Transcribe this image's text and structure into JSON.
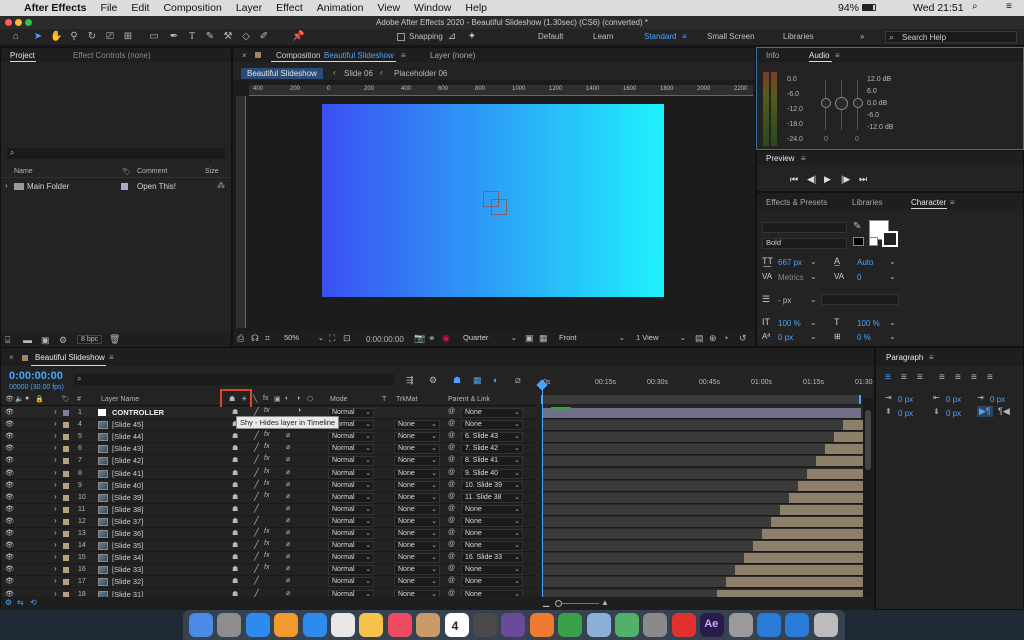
{
  "menubar": {
    "apple": "",
    "app_name": "After Effects",
    "items": [
      "File",
      "Edit",
      "Composition",
      "Layer",
      "Effect",
      "Animation",
      "View",
      "Window",
      "Help"
    ],
    "battery": "94%",
    "clock": "Wed 21:51"
  },
  "titlebar": {
    "title": "Adobe After Effects 2020 - Beautiful Slideshow (1.30sec) (CS6) (converted) *"
  },
  "toolbar": {
    "snapping_label": "Snapping",
    "workspaces": [
      "Default",
      "Learn",
      "Standard",
      "Small Screen",
      "Libraries"
    ],
    "active_workspace": "Standard",
    "search_placeholder": "Search Help"
  },
  "project_panel": {
    "tabs": [
      "Project",
      "Effect Controls (none)"
    ],
    "columns": {
      "name": "Name",
      "comment": "Comment",
      "size": "Size"
    },
    "items": [
      {
        "name": "Main Folder",
        "comment": "Open This!"
      }
    ],
    "bpc": "8 bpc"
  },
  "comp_panel": {
    "tab_prefix": "Composition",
    "comp_name": "Beautiful Slideshow",
    "layer_tab": "Layer (none)",
    "breadcrumbs": [
      "Beautiful Slideshow",
      "Slide 06",
      "Placeholder 06"
    ],
    "ruler_ticks": [
      "400",
      "200",
      "0",
      "200",
      "400",
      "600",
      "800",
      "1000",
      "1200",
      "1400",
      "1600",
      "1800",
      "2000",
      "2200"
    ],
    "zoom": "50%",
    "timecode": "0:00:00:00",
    "resolution": "Quarter",
    "view": "Front",
    "views_count": "1 View",
    "gradient": {
      "start": "#3b4ff2",
      "end": "#1ef2fb"
    }
  },
  "info_panel": {
    "tabs": [
      "Info",
      "Audio"
    ],
    "left_values": [
      "0.0",
      "-6.0",
      "-12.0",
      "-18.0",
      "-24.0"
    ],
    "right_values": [
      "12.0 dB",
      "6.0",
      "0.0 dB",
      "-6.0",
      "-12.0 dB"
    ],
    "zeros": [
      "0",
      "0"
    ]
  },
  "preview_panel": {
    "title": "Preview"
  },
  "effects_panel": {
    "tabs": [
      "Effects & Presets",
      "Libraries",
      "Character"
    ],
    "font_style": "Bold",
    "font_size": "667 px",
    "leading": "Auto",
    "kerning": "Metrics",
    "tracking": "0",
    "stroke_width": "- px",
    "vscale": "100 %",
    "hscale": "100 %",
    "baseline": "0 px",
    "tsume": "0 %"
  },
  "timeline": {
    "comp_name": "Beautiful Slideshow",
    "timecode": "0:00:00:00",
    "frames": "00000 (30.00 fps)",
    "columns": {
      "num": "#",
      "layer_name": "Layer Name",
      "mode": "Mode",
      "t": "T",
      "trkmat": "TrkMat",
      "parent": "Parent & Link"
    },
    "tooltip": "Shy - Hides layer in Timeline",
    "time_marks": [
      "0s",
      "00:15s",
      "00:30s",
      "00:45s",
      "01:00s",
      "01:15s",
      "01:30"
    ],
    "layers": [
      {
        "num": "1",
        "name": "CONTROLLER",
        "mode": "Normal",
        "trkmat": "",
        "parent": "None",
        "color": "#7d7d9e",
        "controller": true
      },
      {
        "num": "4",
        "name": "[Slide 45]",
        "mode": "Normal",
        "trkmat": "None",
        "parent": "None",
        "color": "#b3a37a"
      },
      {
        "num": "5",
        "name": "[Slide 44]",
        "mode": "Normal",
        "trkmat": "None",
        "parent": "6. Slide 43",
        "color": "#b3a37a"
      },
      {
        "num": "6",
        "name": "[Slide 43]",
        "mode": "Normal",
        "trkmat": "None",
        "parent": "7. Slide 42",
        "color": "#b3a37a"
      },
      {
        "num": "7",
        "name": "[Slide 42]",
        "mode": "Normal",
        "trkmat": "None",
        "parent": "8. Slide 41",
        "color": "#b3a37a"
      },
      {
        "num": "8",
        "name": "[Slide 41]",
        "mode": "Normal",
        "trkmat": "None",
        "parent": "9. Slide 40",
        "color": "#b3a37a"
      },
      {
        "num": "9",
        "name": "[Slide 40]",
        "mode": "Normal",
        "trkmat": "None",
        "parent": "10. Slide 39",
        "color": "#b3a37a"
      },
      {
        "num": "10",
        "name": "[Slide 39]",
        "mode": "Normal",
        "trkmat": "None",
        "parent": "11. Slide 38",
        "color": "#b3a37a"
      },
      {
        "num": "11",
        "name": "[Slide 38]",
        "mode": "Normal",
        "trkmat": "None",
        "parent": "None",
        "color": "#b3a37a"
      },
      {
        "num": "12",
        "name": "[Slide 37]",
        "mode": "Normal",
        "trkmat": "None",
        "parent": "None",
        "color": "#b3a37a"
      },
      {
        "num": "13",
        "name": "[Slide 36]",
        "mode": "Normal",
        "trkmat": "None",
        "parent": "None",
        "color": "#b3a37a"
      },
      {
        "num": "14",
        "name": "[Slide 35]",
        "mode": "Normal",
        "trkmat": "None",
        "parent": "None",
        "color": "#b3a37a"
      },
      {
        "num": "15",
        "name": "[Slide 34]",
        "mode": "Normal",
        "trkmat": "None",
        "parent": "16. Slide 33",
        "color": "#b3a37a"
      },
      {
        "num": "16",
        "name": "[Slide 33]",
        "mode": "Normal",
        "trkmat": "None",
        "parent": "None",
        "color": "#b3a37a"
      },
      {
        "num": "17",
        "name": "[Slide 32]",
        "mode": "Normal",
        "trkmat": "None",
        "parent": "None",
        "color": "#b3a37a"
      },
      {
        "num": "18",
        "name": "[Slide 31]",
        "mode": "Normal",
        "trkmat": "None",
        "parent": "None",
        "color": "#b3a37a"
      }
    ]
  },
  "paragraph_panel": {
    "title": "Paragraph",
    "indent_values": [
      "0 px",
      "0 px",
      "0 px",
      "0 px",
      "0 px"
    ]
  },
  "dock": {
    "calendar_day": "4",
    "app_icons": [
      "finder",
      "launchpad",
      "safari",
      "books",
      "appstore",
      "chrome",
      "photos",
      "music",
      "contacts",
      "calendar",
      "clips",
      "finalcut",
      "garageband",
      "numbers",
      "preview",
      "maps",
      "systemprefs",
      "creativecloud",
      "aftereffects",
      "scripteditor",
      "globe",
      "globe",
      "trash"
    ]
  }
}
